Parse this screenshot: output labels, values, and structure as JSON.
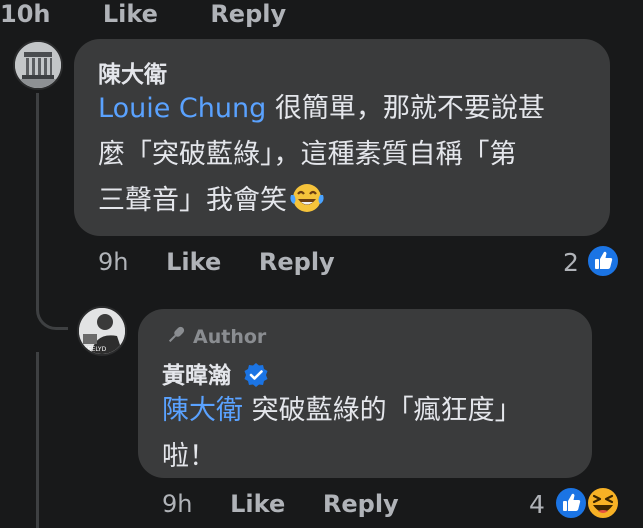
{
  "top_row": {
    "time": "10h",
    "like": "Like",
    "reply": "Reply"
  },
  "comment1": {
    "author": "陳大衛",
    "mention": "Louie Chung",
    "lines": [
      "很簡單，那就不要說甚",
      "麼「突破藍綠」，這種素質自稱「第",
      "三聲音」我會笑"
    ],
    "emoji": "laughing-tears",
    "time": "9h",
    "like": "Like",
    "reply": "Reply",
    "reaction_count": "2",
    "reactions": [
      "like"
    ]
  },
  "comment2": {
    "badge": "Author",
    "author": "黃暐瀚",
    "verified": true,
    "mention": "陳大衛",
    "lines": [
      "突破藍綠的「瘋狂度」",
      "啦！"
    ],
    "time": "9h",
    "like": "Like",
    "reply": "Reply",
    "reaction_count": "4",
    "reactions": [
      "like",
      "haha"
    ]
  },
  "colors": {
    "background": "#18191a",
    "bubble": "#3a3b3c",
    "mention": "#5aa2ff",
    "like_blue": "#1b74e4",
    "haha_yellow": "#f7b125",
    "secondary_text": "#b0b3b8"
  }
}
